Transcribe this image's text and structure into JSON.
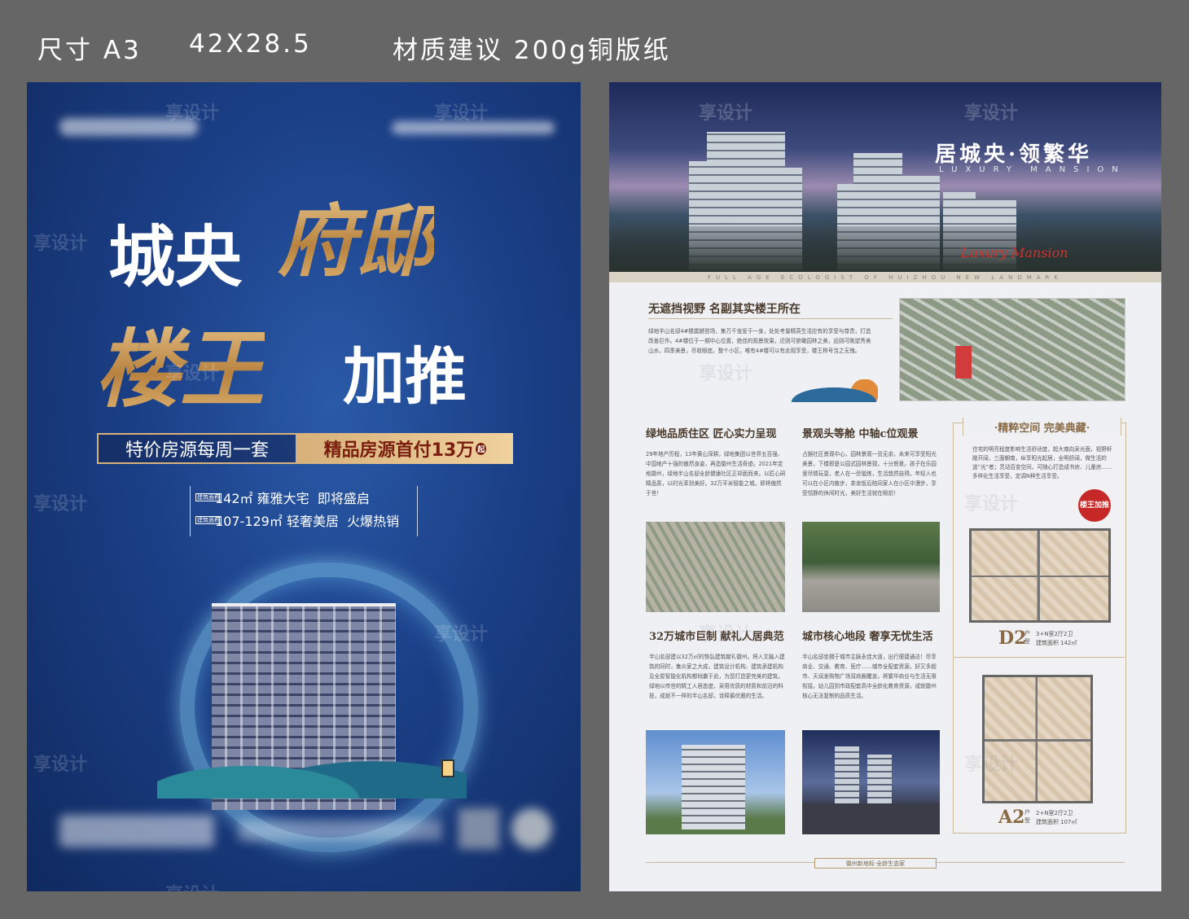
{
  "header": {
    "size_label": "尺寸 A3",
    "dimensions": "42X28.5",
    "material": "材质建议 200g铜版纸"
  },
  "poster": {
    "headline_white_1": "城央",
    "headline_gold_1": "府邸",
    "headline_gold_2": "楼王",
    "headline_white_2": "加推",
    "banner_left": "特价房源每周一套",
    "banner_right": "精品房源首付13万",
    "banner_right_suffix": "起",
    "spec_tag": "建筑面积",
    "spec_rows": [
      {
        "area": "142㎡",
        "type": "雍雅大宅",
        "status": "即将盛启"
      },
      {
        "area": "107-129㎡",
        "type": "轻奢美居",
        "status": "火爆热销"
      }
    ]
  },
  "brochure": {
    "hero_title": "居城央·领繁华",
    "hero_subtitle": "LUXURY MANSION",
    "hero_script": "Luxury Mansion",
    "tagline": "FULL AGE ECOLOGIST OF HUIZHOU NEW LANDMARK",
    "section1": {
      "title": "无遮挡视野  名副其实楼王所在",
      "body": "绿地半山名邸4#楼震撼登场，集万千宠爱于一身，处处考量精英生活应有的享受与尊贵，打造改善巨作。4#楼位于一期中心位置，绝佳的观景效果，近则可俯瞰园林之美，远则可眺望秀美山水，四季美景，尽收眼底。整个小区，唯有4#楼可以有此观享受，楼王称号当之无愧。"
    },
    "section2": {
      "title": "绿地品质住区  匠心实力呈现",
      "body": "29年地产历程，13年黄山深耕，绿地集团以世界五百强、中国地产十强的傲然身姿，再造徽州生活奇迹。2021年定格徽州，绿地半山名邸全龄健康社区正却面而来。以匠心研精品质，以时光萃到美好。32万平米智能之城，即将傲然于世！"
    },
    "section3": {
      "title": "景观头等舱  中轴c位观景",
      "body": "占据社区景观中心，园林景观一览无余，未来可享受阳光美景，下楼即是公园式园林景观，十分惬意。孩子在乐园里尽情玩耍，老人在一旁锻炼，生活悠然自得。年轻人也可以在小区内散步，茶余饭后陪同家人在小区中漫步，享受恬静的休闲时光，美好生活就在眼前！"
    },
    "section4": {
      "title": "32万城市巨制  献礼人居典范",
      "body": "半山名邸建以32万㎡的恢弘建筑献礼徽州。将人文融入建筑的同时，集众家之大成，建筑设计机构、建筑承建机构及全屋智能化机构都倾囊于此，为您打造更完美的建筑。绿地以传世的精工人居态度，采用优质的材质和前沿的科技，成就不一样的半山名邸，诠释最优雅的生活。"
    },
    "section5": {
      "title": "城市核心地段  奢享无忧生活",
      "body": "半山名邸坐拥于城市主脉永佳大道，出行便捷通达！尽享商业、交通、教育、医疗……城市全配套资源，好又多超市、天润发购物广场双商圈覆盖，将繁华商业与生活无限衔接。幼儿园到市政配套高中全龄化教育资源，成就徽州核心无法复制的品质生活。"
    },
    "card": {
      "title": "·精粹空间  完美典藏·",
      "body": "住宅的明亮程度影响生活舒适度，超大南向采光面，视野轩敞开阔，三面朝南，纵享阳光起居，全明舒阔，做生活的送“光”者；灵动百变空间，可随心打造成书房、儿童房……多样化生活享受，定调N种生活享受。",
      "badge": "楼王加推",
      "plan1": {
        "label": "D2",
        "suffix": "户型",
        "rooms": "3+N室2厅2卫",
        "area_label": "建筑面积",
        "area": "142㎡"
      },
      "plan2": {
        "label": "A2",
        "suffix": "户型",
        "rooms": "2+N室2厅2卫",
        "area_label": "建筑面积",
        "area": "107㎡"
      }
    },
    "footer": "徽州新地标·全龄生态家"
  },
  "watermark": "享设计"
}
